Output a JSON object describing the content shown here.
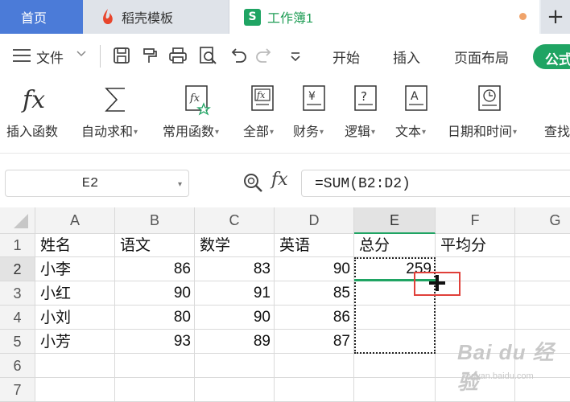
{
  "tabs": {
    "home": "首页",
    "template": "稻壳模板",
    "workbook": "工作簿1",
    "workbook_icon": "S",
    "add": "+"
  },
  "menu": {
    "file": "文件",
    "items": [
      "开始",
      "插入",
      "页面布局"
    ],
    "formula": "公式"
  },
  "ribbon": {
    "insert_function": "插入函数",
    "autosum": "自动求和",
    "common": "常用函数",
    "all": "全部",
    "finance": "财务",
    "logic": "逻辑",
    "text": "文本",
    "datetime": "日期和时间",
    "lookup": "查找"
  },
  "formula_bar": {
    "name_box": "E2",
    "fx": "fx",
    "formula": "=SUM(B2:D2)"
  },
  "sheet": {
    "columns": [
      "A",
      "B",
      "C",
      "D",
      "E",
      "F",
      "G"
    ],
    "rows": [
      "1",
      "2",
      "3",
      "4",
      "5",
      "6",
      "7"
    ],
    "active_column": "E",
    "active_row": "2",
    "cells": {
      "A1": "姓名",
      "B1": "语文",
      "C1": "数学",
      "D1": "英语",
      "E1": "总分",
      "F1": "平均分",
      "A2": "小李",
      "B2": "86",
      "C2": "83",
      "D2": "90",
      "E2": "259",
      "A3": "小红",
      "B3": "90",
      "C3": "91",
      "D3": "85",
      "A4": "小刘",
      "B4": "80",
      "C4": "90",
      "D4": "86",
      "A5": "小芳",
      "B5": "93",
      "C5": "89",
      "D5": "87"
    }
  },
  "watermark": {
    "brand": "Bai du 经验",
    "url": "jingyan.baidu.com"
  },
  "colors": {
    "home_tab": "#4b7bd8",
    "accent_green": "#1fa463",
    "highlight_red": "#e0403a"
  }
}
